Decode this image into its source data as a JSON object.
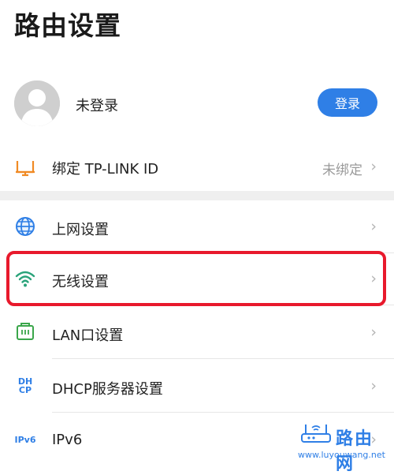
{
  "page": {
    "title": "路由设置"
  },
  "account": {
    "name": "未登录",
    "login_label": "登录"
  },
  "bind": {
    "label": "绑定 TP-LINK ID",
    "status": "未绑定",
    "chevron": "›"
  },
  "menu": {
    "items": [
      {
        "label": "上网设置",
        "chevron": "›",
        "icon": "globe-icon"
      },
      {
        "label": "无线设置",
        "chevron": "›",
        "icon": "wifi-icon"
      },
      {
        "label": "LAN口设置",
        "chevron": "›",
        "icon": "lan-port-icon"
      },
      {
        "label": "DHCP服务器设置",
        "chevron": "›",
        "icon": "dhcp-icon",
        "icon_text_top": "DH",
        "icon_text_bottom": "CP"
      },
      {
        "label": "IPv6",
        "chevron": "›",
        "icon": "ipv6-icon",
        "icon_text": "IPv6"
      }
    ]
  },
  "watermark": {
    "brand": "路由网",
    "url": "www.luyouwang.net"
  },
  "colors": {
    "accent": "#2f7fe6",
    "highlight": "#e8192c",
    "bind_icon": "#f08a24",
    "wifi": "#2aa37a",
    "lan": "#3aa64a"
  }
}
